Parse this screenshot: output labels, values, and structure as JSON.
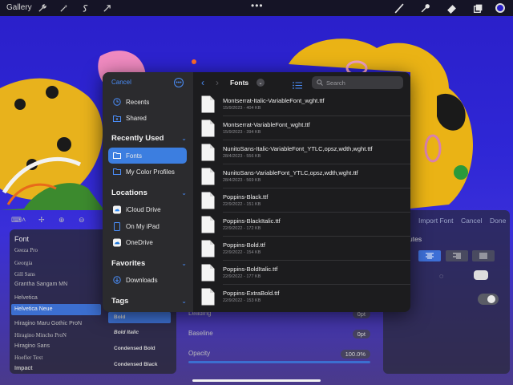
{
  "toolbar": {
    "gallery_label": "Gallery",
    "menu_dots": "•••"
  },
  "text_tool": {
    "import_font_label": "Import Font",
    "cancel_label": "Cancel",
    "done_label": "Done",
    "font_header": "Font",
    "fonts": [
      "Geeza Pro",
      "Georgia",
      "Gill Sans",
      "Grantha Sangam MN",
      "Helvetica",
      "Helvetica Neue",
      "Hiragino Maru Gothic ProN",
      "Hiragino Mincho ProN",
      "Hiragino Sans",
      "Hoefler Text",
      "Impact"
    ],
    "selected_font": "Helvetica Neue",
    "styles": [
      "Bold",
      "Bold Italic",
      "Condensed Bold",
      "Condensed Black"
    ],
    "selected_style": "Bold",
    "attributes_partial": "utes",
    "leading_label": "Leading",
    "leading_value": "0pt",
    "baseline_label": "Baseline",
    "baseline_value": "0pt",
    "opacity_label": "Opacity",
    "opacity_value": "100.0%",
    "opacity_fraction": 1.0
  },
  "picker": {
    "cancel_label": "Cancel",
    "recents_label": "Recents",
    "shared_label": "Shared",
    "recently_used_header": "Recently Used",
    "recently_used": [
      "Fonts",
      "My Color Profiles"
    ],
    "active_item": "Fonts",
    "locations_header": "Locations",
    "locations": [
      "iCloud Drive",
      "On My iPad",
      "OneDrive"
    ],
    "favorites_header": "Favorites",
    "favorites": [
      "Downloads"
    ],
    "tags_header": "Tags",
    "current_folder": "Fonts",
    "search_placeholder": "Search",
    "files": [
      {
        "name": "Montserrat-Italic-VariableFont_wght.ttf",
        "meta": "15/9/2023 - 404 KB"
      },
      {
        "name": "Montserrat-VariableFont_wght.ttf",
        "meta": "15/9/2023 - 394 KB"
      },
      {
        "name": "NunitoSans-Italic-VariableFont_YTLC,opsz,wdth,wght.ttf",
        "meta": "28/4/2023 - 556 KB"
      },
      {
        "name": "NunitoSans-VariableFont_YTLC,opsz,wdth,wght.ttf",
        "meta": "28/4/2023 - 569 KB"
      },
      {
        "name": "Poppins-Black.ttf",
        "meta": "22/9/2022 - 151 KB"
      },
      {
        "name": "Poppins-BlackItalic.ttf",
        "meta": "22/9/2022 - 172 KB"
      },
      {
        "name": "Poppins-Bold.ttf",
        "meta": "22/9/2022 - 154 KB"
      },
      {
        "name": "Poppins-BoldItalic.ttf",
        "meta": "22/9/2022 - 177 KB"
      },
      {
        "name": "Poppins-ExtraBold.ttf",
        "meta": "22/9/2022 - 153 KB"
      }
    ]
  },
  "colors": {
    "accent": "#4a8df8",
    "active_row": "#3c7ee0",
    "canvas_blue": "#2f27d6"
  },
  "icons": {
    "toolbar": [
      "wrench-icon",
      "magic-wand-icon",
      "selection-s-icon",
      "transform-arrow-icon",
      "brush-icon",
      "smudge-icon",
      "eraser-icon",
      "layers-icon",
      "color-swatch-icon"
    ],
    "sidebar": [
      "clock-icon",
      "shared-folder-icon",
      "folder-icon",
      "folder-icon",
      "icloud-icon",
      "ipad-icon",
      "onedrive-cloud-icon",
      "download-circle-icon"
    ]
  }
}
